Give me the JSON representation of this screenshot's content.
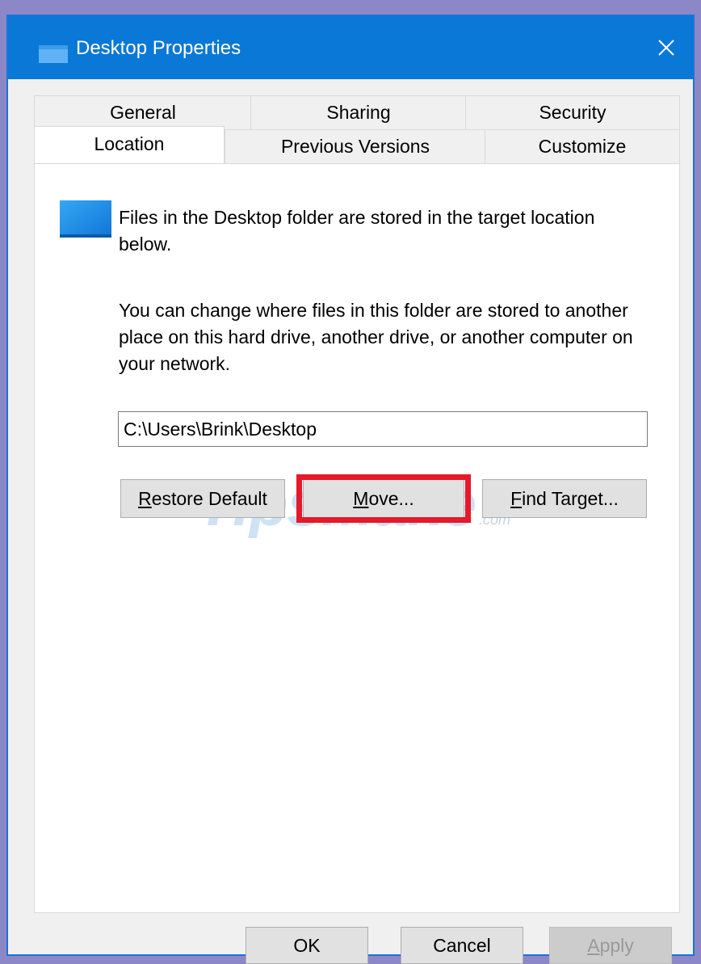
{
  "window": {
    "title": "Desktop Properties",
    "close_glyph": "✕",
    "title_icon": "folder-icon"
  },
  "tabs_row1": [
    {
      "label": "General"
    },
    {
      "label": "Sharing"
    },
    {
      "label": "Security"
    }
  ],
  "tabs_row2": [
    {
      "label": "Location",
      "active": true
    },
    {
      "label": "Previous Versions"
    },
    {
      "label": "Customize"
    }
  ],
  "location": {
    "folder_icon": "folder-icon",
    "description_1": "Files in the Desktop folder are stored in the target location below.",
    "description_2": "You can change where files in this folder are stored to another place on this hard drive, another drive, or another computer on your network.",
    "path_value": "C:\\Users\\Brink\\Desktop",
    "restore_default": {
      "prefix": "R",
      "rest": "estore Default"
    },
    "move": {
      "prefix": "M",
      "rest": "ove..."
    },
    "find_target": {
      "prefix": "F",
      "rest": "ind Target..."
    }
  },
  "watermark": {
    "main": "TipsMake",
    "suffix": ".com"
  },
  "footer": {
    "ok": "OK",
    "cancel": "Cancel",
    "apply": {
      "prefix": "A",
      "rest": "pply"
    }
  },
  "colors": {
    "titlebar": "#0a78d7",
    "highlight": "#e5192a",
    "background": "#8c88c8"
  }
}
